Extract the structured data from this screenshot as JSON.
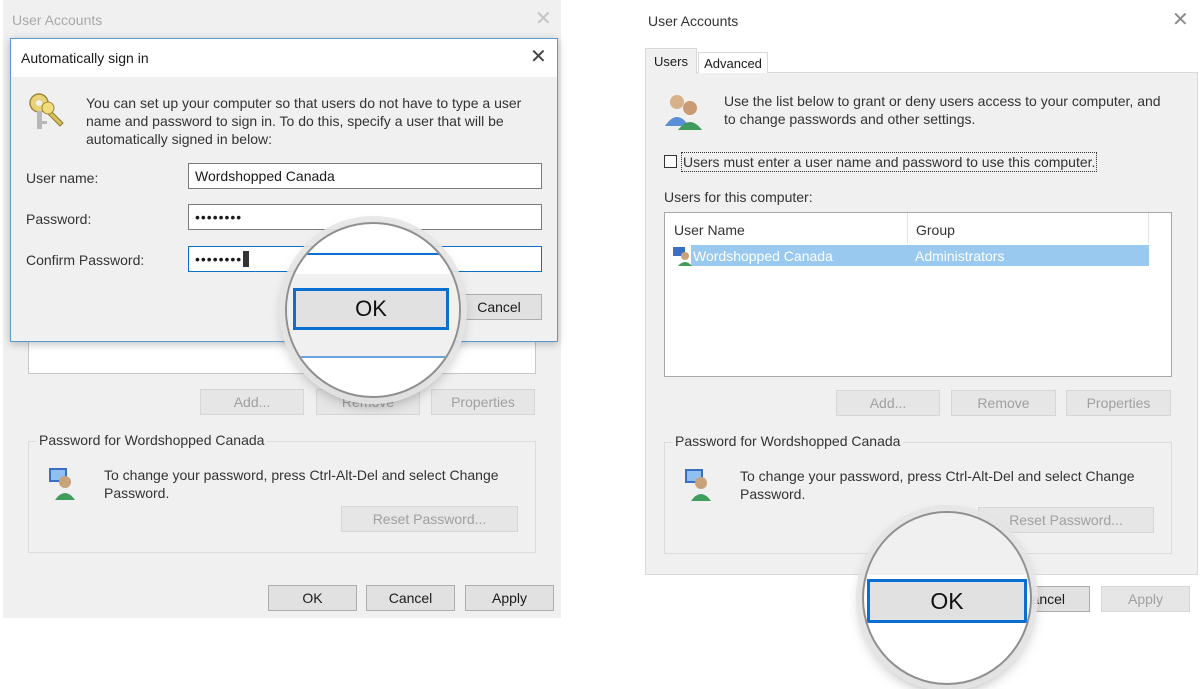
{
  "left_window": {
    "title": "User Accounts",
    "add_label": "Add...",
    "remove_label": "Remove",
    "properties_label": "Properties",
    "password_group_label": "Password for Wordshopped Canada",
    "password_text": "To change your password, press Ctrl-Alt-Del and select Change Password.",
    "reset_password_label": "Reset Password...",
    "ok_label": "OK",
    "cancel_label": "Cancel",
    "apply_label": "Apply"
  },
  "autosignin_dialog": {
    "title": "Automatically sign in",
    "description": "You can set up your computer so that users do not have to type a user name and password to sign in. To do this, specify a user that will be automatically signed in below:",
    "username_label": "User name:",
    "username_value": "Wordshopped Canada",
    "password_label": "Password:",
    "password_value": "••••••••",
    "confirm_label": "Confirm Password:",
    "confirm_value": "••••••••",
    "ok_label": "OK",
    "cancel_label": "Cancel"
  },
  "right_window": {
    "title": "User Accounts",
    "tabs": [
      {
        "label": "Users",
        "active": true
      },
      {
        "label": "Advanced",
        "active": false
      }
    ],
    "intro_text": "Use the list below to grant or deny users access to your computer, and to change passwords and other settings.",
    "checkbox_label": "Users must enter a user name and password to use this computer.",
    "checkbox_checked": false,
    "users_list_label": "Users for this computer:",
    "columns": [
      "User Name",
      "Group"
    ],
    "rows": [
      {
        "user": "Wordshopped Canada",
        "group": "Administrators",
        "selected": true
      }
    ],
    "add_label": "Add...",
    "remove_label": "Remove",
    "properties_label": "Properties",
    "password_group_label": "Password for Wordshopped Canada",
    "password_text": "To change your password, press Ctrl-Alt-Del and select Change Password.",
    "reset_password_label": "Reset Password...",
    "ok_label": "OK",
    "cancel_label": "ancel",
    "apply_label": "Apply"
  },
  "colors": {
    "accent": "#0a6fd0",
    "selection": "#99c9ef",
    "dialog_bg": "#f0f0f0"
  }
}
